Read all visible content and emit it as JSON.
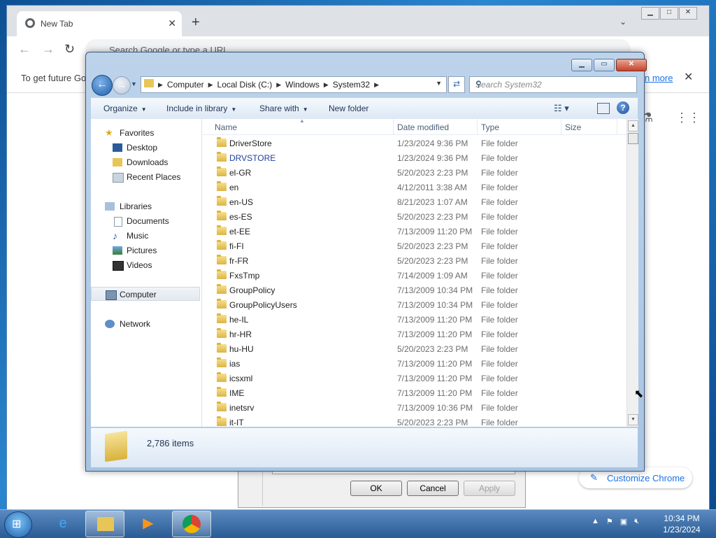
{
  "chrome": {
    "tab_title": "New Tab",
    "tab_close": "✕",
    "new_tab": "+",
    "omnibox_placeholder": "Search Google or type a URL",
    "infobar_text": "To get future Go",
    "infobar_link": "n more",
    "infobar_close": "✕",
    "customize_label": "Customize Chrome",
    "window_controls": [
      "▁",
      "□",
      "✕"
    ]
  },
  "dialog": {
    "caption_controls": [
      "▁",
      "▭",
      "✕"
    ],
    "breadcrumbs": [
      "Computer",
      "Local Disk (C:)",
      "Windows",
      "System32"
    ],
    "search_placeholder": "Search System32",
    "commands": {
      "organize": "Organize",
      "include_in_library": "Include in library",
      "share_with": "Share with",
      "new_folder": "New folder"
    },
    "nav": {
      "favorites": "Favorites",
      "desktop": "Desktop",
      "downloads": "Downloads",
      "recent_places": "Recent Places",
      "libraries": "Libraries",
      "documents": "Documents",
      "music": "Music",
      "pictures": "Pictures",
      "videos": "Videos",
      "computer": "Computer",
      "network": "Network"
    },
    "columns": [
      "Name",
      "Date modified",
      "Type",
      "Size"
    ],
    "rows": [
      {
        "name": "DriverStore",
        "date": "1/23/2024 9:36 PM",
        "type": "File folder"
      },
      {
        "name": "DRVSTORE",
        "date": "1/23/2024 9:36 PM",
        "type": "File folder"
      },
      {
        "name": "el-GR",
        "date": "5/20/2023 2:23 PM",
        "type": "File folder"
      },
      {
        "name": "en",
        "date": "4/12/2011 3:38 AM",
        "type": "File folder"
      },
      {
        "name": "en-US",
        "date": "8/21/2023 1:07 AM",
        "type": "File folder"
      },
      {
        "name": "es-ES",
        "date": "5/20/2023 2:23 PM",
        "type": "File folder"
      },
      {
        "name": "et-EE",
        "date": "7/13/2009 11:20 PM",
        "type": "File folder"
      },
      {
        "name": "fi-FI",
        "date": "5/20/2023 2:23 PM",
        "type": "File folder"
      },
      {
        "name": "fr-FR",
        "date": "5/20/2023 2:23 PM",
        "type": "File folder"
      },
      {
        "name": "FxsTmp",
        "date": "7/14/2009 1:09 AM",
        "type": "File folder"
      },
      {
        "name": "GroupPolicy",
        "date": "7/13/2009 10:34 PM",
        "type": "File folder"
      },
      {
        "name": "GroupPolicyUsers",
        "date": "7/13/2009 10:34 PM",
        "type": "File folder"
      },
      {
        "name": "he-IL",
        "date": "7/13/2009 11:20 PM",
        "type": "File folder"
      },
      {
        "name": "hr-HR",
        "date": "7/13/2009 11:20 PM",
        "type": "File folder"
      },
      {
        "name": "hu-HU",
        "date": "5/20/2023 2:23 PM",
        "type": "File folder"
      },
      {
        "name": "ias",
        "date": "7/13/2009 11:20 PM",
        "type": "File folder"
      },
      {
        "name": "icsxml",
        "date": "7/13/2009 11:20 PM",
        "type": "File folder"
      },
      {
        "name": "IME",
        "date": "7/13/2009 11:20 PM",
        "type": "File folder"
      },
      {
        "name": "inetsrv",
        "date": "7/13/2009 10:36 PM",
        "type": "File folder"
      },
      {
        "name": "it-IT",
        "date": "5/20/2023 2:23 PM",
        "type": "File folder"
      }
    ],
    "item_count": "2,786 items"
  },
  "properties_dialog": {
    "ok": "OK",
    "cancel": "Cancel",
    "apply": "Apply"
  },
  "taskbar": {
    "time": "10:34 PM",
    "date": "1/23/2024"
  },
  "colors": {
    "link_blue": "#1a73e8",
    "selected_name": "#1f3fa0",
    "folder_yellow": "#e7c657"
  }
}
